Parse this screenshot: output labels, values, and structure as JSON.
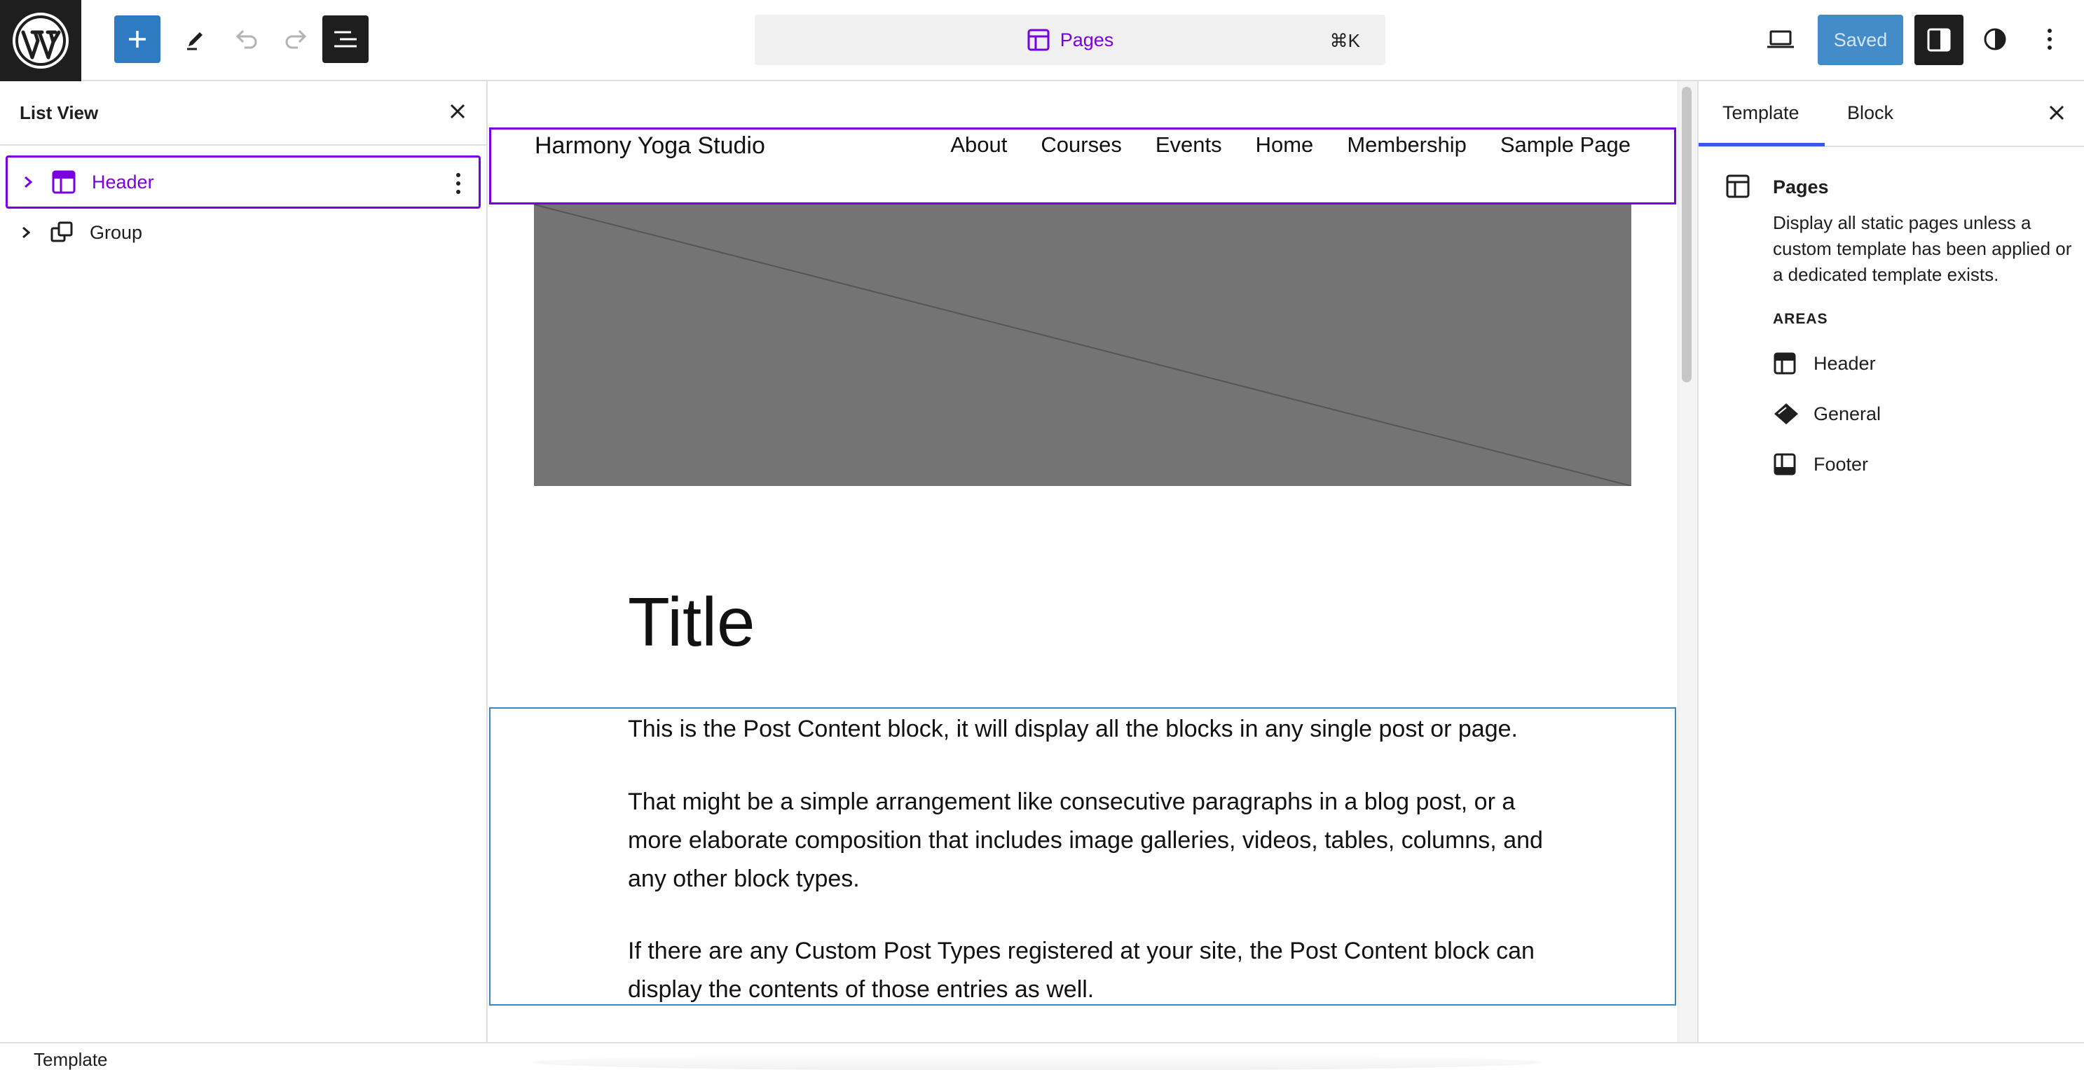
{
  "toolbar": {
    "command_label": "Pages",
    "command_shortcut": "⌘K",
    "saved_label": "Saved"
  },
  "list_view": {
    "title": "List View",
    "items": [
      {
        "label": "Header",
        "icon": "template-part-header-icon",
        "selected": true
      },
      {
        "label": "Group",
        "icon": "group-icon",
        "selected": false
      }
    ]
  },
  "canvas": {
    "site_title": "Harmony Yoga Studio",
    "nav": [
      "About",
      "Courses",
      "Events",
      "Home",
      "Membership",
      "Sample Page"
    ],
    "post_title": "Title",
    "paragraphs": [
      "This is the Post Content block, it will display all the blocks in any single post or page.",
      "That might be a simple arrangement like consecutive paragraphs in a blog post, or a more elaborate composition that includes image galleries, videos, tables, columns, and any other block types.",
      "If there are any Custom Post Types registered at your site, the Post Content block can display the contents of those entries as well."
    ]
  },
  "sidebar": {
    "tabs": [
      "Template",
      "Block"
    ],
    "active_tab": "Template",
    "template_name": "Pages",
    "template_description": "Display all static pages unless a custom template has been applied or a dedicated template exists.",
    "areas_label": "AREAS",
    "areas": [
      {
        "label": "Header",
        "icon": "header-icon"
      },
      {
        "label": "General",
        "icon": "general-icon"
      },
      {
        "label": "Footer",
        "icon": "footer-icon"
      }
    ]
  },
  "footer": {
    "breadcrumb": "Template"
  },
  "colors": {
    "accent_purple": "#7a00df",
    "primary_blue": "#2f7bc2",
    "dark": "#1e1e1e"
  }
}
